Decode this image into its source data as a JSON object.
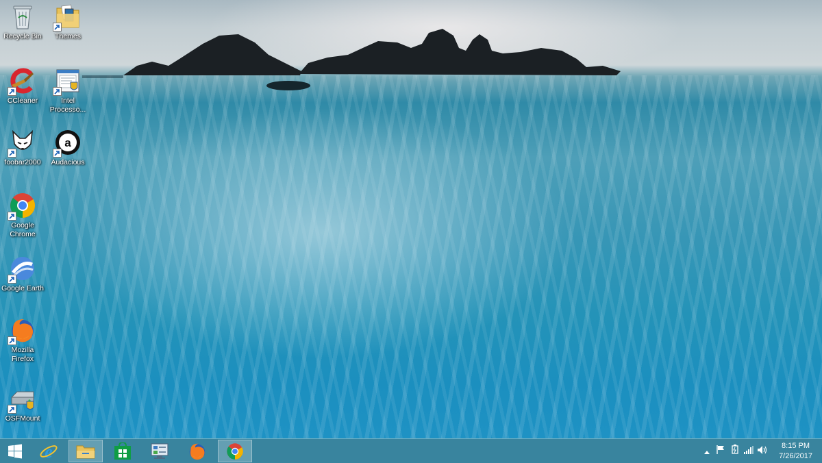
{
  "desktop": {
    "icons": [
      {
        "id": "recycle-bin",
        "label": "Recycle Bin"
      },
      {
        "id": "themes",
        "label": "Themes"
      },
      {
        "id": "ccleaner",
        "label": "CCleaner"
      },
      {
        "id": "intel",
        "label": "Intel Processo..."
      },
      {
        "id": "foobar2000",
        "label": "foobar2000"
      },
      {
        "id": "audacious",
        "label": "Audacious"
      },
      {
        "id": "google-chrome",
        "label": "Google Chrome"
      },
      {
        "id": "google-earth",
        "label": "Google Earth"
      },
      {
        "id": "mozilla-firefox",
        "label": "Mozilla Firefox"
      },
      {
        "id": "osfmount",
        "label": "OSFMount"
      }
    ]
  },
  "taskbar": {
    "pinned": [
      "start-icon",
      "internet-explorer-icon",
      "file-explorer-icon",
      "store-icon",
      "control-panel-icon",
      "firefox-icon",
      "chrome-icon"
    ],
    "tray": {
      "icons": [
        "show-hidden-icons-chevron",
        "action-center-flag-icon",
        "power-battery-icon",
        "network-signal-icon",
        "volume-icon"
      ],
      "time": "8:15 PM",
      "date": "7/26/2017"
    }
  },
  "colors": {
    "taskbar": "#287a96",
    "water": "#1e92c4",
    "rocks": "#1b2024"
  }
}
